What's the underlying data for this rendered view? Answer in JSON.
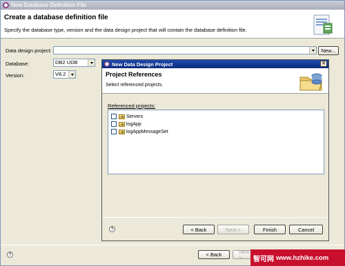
{
  "window": {
    "title": "New Database Definition File",
    "banner_title": "Create a database definition file",
    "banner_desc": "Specify the database type, version and the data design project that will contain the database definition file."
  },
  "form": {
    "project_label": "Data design project:",
    "project_value": "",
    "new_label": "New...",
    "database_label": "Database:",
    "database_value": "DB2 UDB",
    "version_label": "Version:",
    "version_value": "V8.2"
  },
  "footer": {
    "help": "?",
    "back_label": "< Back",
    "next_label": "Next >"
  },
  "dialog": {
    "title": "New Data Design Project",
    "close": "✕",
    "banner_title": "Project References",
    "banner_desc": "Select referenced projects.",
    "list_label": "Referenced projects:",
    "projects": [
      {
        "label": "Servers",
        "checked": false
      },
      {
        "label": "logApp",
        "checked": false
      },
      {
        "label": "logAppMessageSet",
        "checked": false
      }
    ],
    "help": "?",
    "back_label": "< Back",
    "next_label": "Next >",
    "finish_label": "Finish",
    "cancel_label": "Cancel"
  },
  "watermark": {
    "text": "智可网",
    "url": "www.hzhike.com"
  },
  "colors": {
    "dialog_title_bar": "#0a2a7a",
    "watermark_bg": "#c8102e",
    "field_border": "#7f9db9"
  }
}
